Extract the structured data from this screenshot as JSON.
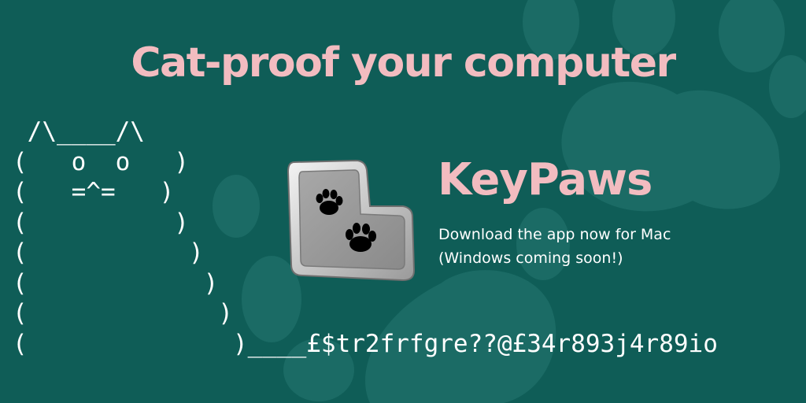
{
  "banner": {
    "headline": "Cat-proof your computer",
    "ascii_cat_lines": [
      " /\\____/\\",
      "(   o  o   )",
      "(   =^=   )",
      "(          )",
      "(           )",
      "(            )",
      "(             )",
      "(              )____£$tr2frfgre??@£34r893j4r89io"
    ],
    "app": {
      "name": "KeyPaws",
      "tagline_line1": "Download the app now for Mac",
      "tagline_line2": "(Windows coming soon!)",
      "icon": "paw-key-icon"
    },
    "background_decoration": "paw-print-icon"
  },
  "colors": {
    "background": "#0f5d57",
    "paw_pattern": "#1b6b65",
    "accent_pink": "#f2bcc0",
    "text_white": "#ffffff"
  }
}
